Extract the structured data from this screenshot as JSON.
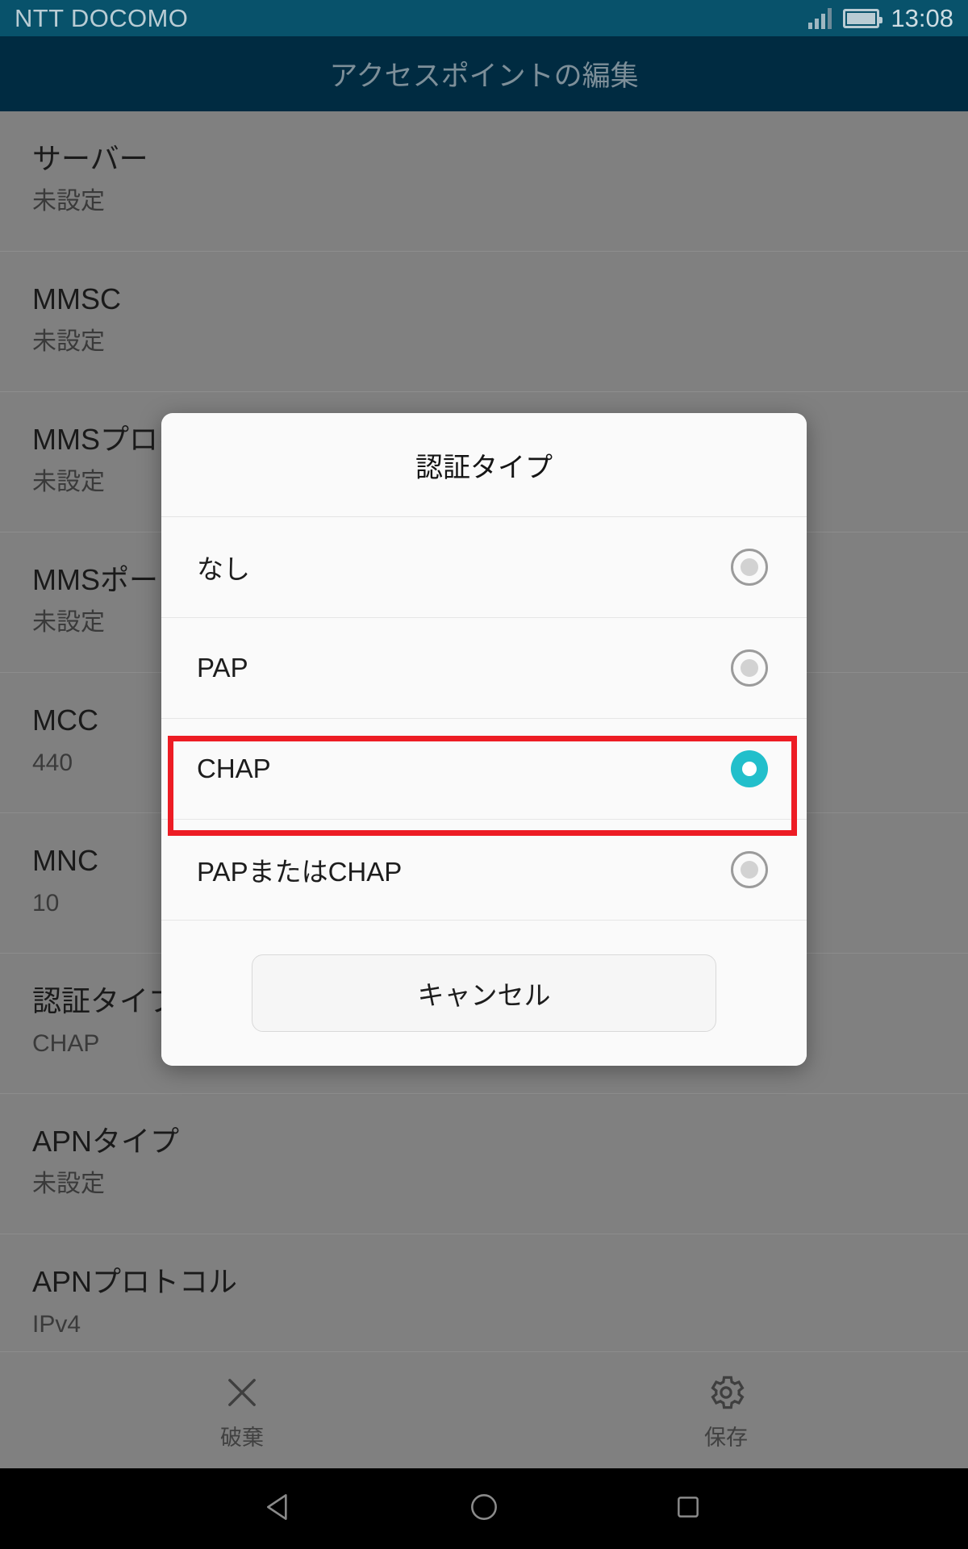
{
  "status_bar": {
    "carrier": "NTT DOCOMO",
    "clock": "13:08",
    "signal_icon": "signal-bars-icon",
    "battery_icon": "battery-full-icon",
    "background_color": "#08526b"
  },
  "app_bar": {
    "title": "アクセスポイントの編集",
    "background_color": "#002b41",
    "title_color": "#7d8f99"
  },
  "settings_list": {
    "rows": [
      {
        "title": "サーバー",
        "summary": "未設定"
      },
      {
        "title": "MMSC",
        "summary": "未設定"
      },
      {
        "title": "MMSプロキシ",
        "summary": "未設定"
      },
      {
        "title": "MMSポート",
        "summary": "未設定"
      },
      {
        "title": "MCC",
        "summary": "440"
      },
      {
        "title": "MNC",
        "summary": "10"
      },
      {
        "title": "認証タイプ",
        "summary": "CHAP"
      },
      {
        "title": "APNタイプ",
        "summary": "未設定"
      },
      {
        "title": "APNプロトコル",
        "summary": "IPv4"
      }
    ]
  },
  "dialog": {
    "title": "認証タイプ",
    "options": [
      {
        "label": "なし",
        "selected": false
      },
      {
        "label": "PAP",
        "selected": false
      },
      {
        "label": "CHAP",
        "selected": true
      },
      {
        "label": "PAPまたはCHAP",
        "selected": false
      }
    ],
    "cancel_label": "キャンセル",
    "selected_color": "#22bfcb",
    "background_color": "#fafafa"
  },
  "annotation": {
    "highlight_target": "CHAP",
    "highlight_color": "#ed1c24"
  },
  "action_bar": {
    "buttons": [
      {
        "label": "破棄",
        "icon": "close-x-icon"
      },
      {
        "label": "保存",
        "icon": "gear-icon"
      }
    ]
  },
  "nav_bar": {
    "buttons": [
      {
        "icon": "back-triangle-icon"
      },
      {
        "icon": "home-circle-icon"
      },
      {
        "icon": "recents-square-icon"
      }
    ],
    "background_color": "#000000"
  }
}
